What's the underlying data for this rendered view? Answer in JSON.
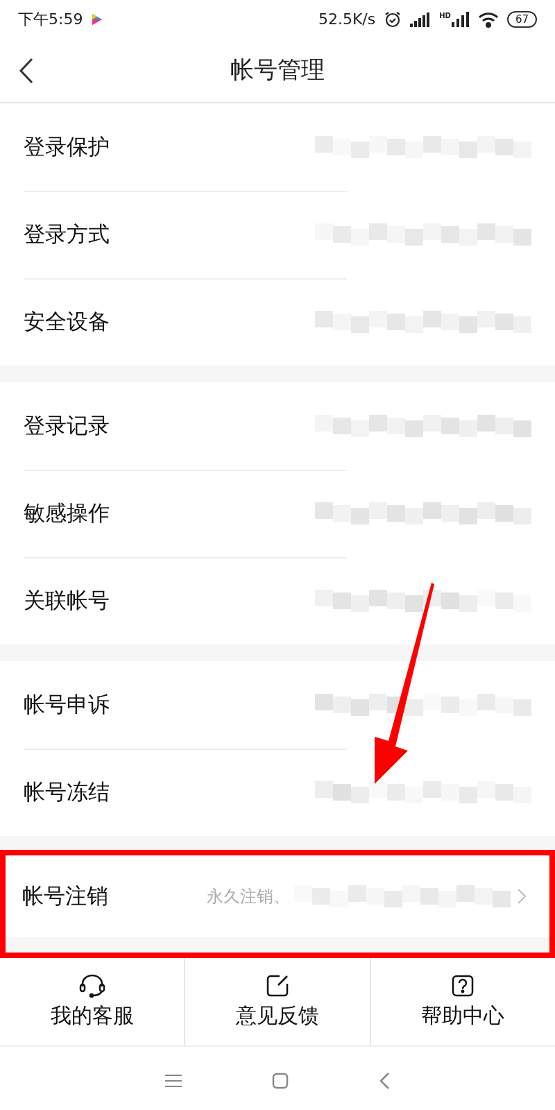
{
  "status_bar": {
    "time": "下午5:59",
    "speed": "52.5K/s",
    "network": "HD",
    "battery": "67"
  },
  "header": {
    "title": "帐号管理"
  },
  "groups": [
    {
      "highlighted": false,
      "items": [
        {
          "label": "登录保护",
          "chevron": false
        },
        {
          "label": "登录方式",
          "chevron": false
        },
        {
          "label": "安全设备",
          "chevron": false
        }
      ]
    },
    {
      "highlighted": false,
      "items": [
        {
          "label": "登录记录",
          "chevron": false
        },
        {
          "label": "敏感操作",
          "chevron": false
        },
        {
          "label": "关联帐号",
          "chevron": false
        }
      ]
    },
    {
      "highlighted": false,
      "items": [
        {
          "label": "帐号申诉",
          "chevron": false
        },
        {
          "label": "帐号冻结",
          "chevron": false
        }
      ]
    },
    {
      "highlighted": true,
      "items": [
        {
          "label": "帐号注销",
          "value": "永久注销、",
          "chevron": true
        }
      ]
    }
  ],
  "bottom_tabs": [
    {
      "kind": "headset",
      "label": "我的客服"
    },
    {
      "kind": "edit",
      "label": "意见反馈"
    },
    {
      "kind": "help",
      "label": "帮助中心"
    }
  ]
}
